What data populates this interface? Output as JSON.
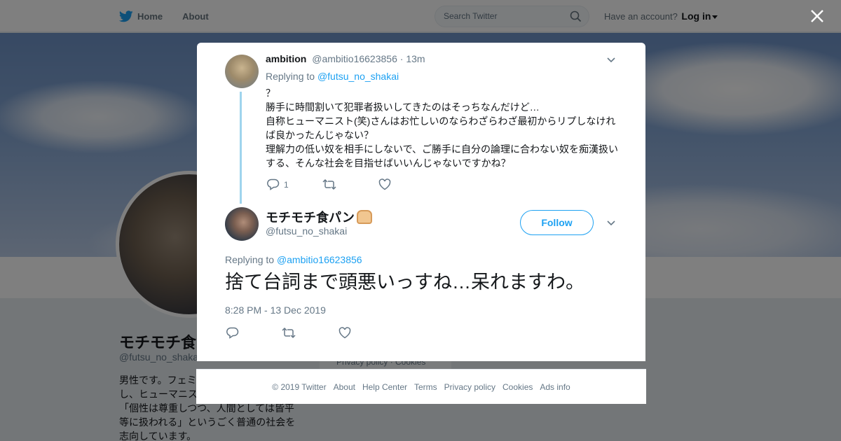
{
  "nav": {
    "home_label": "Home",
    "about_label": "About",
    "search_placeholder": "Search Twitter",
    "have_account": "Have an account?",
    "login_label": "Log in"
  },
  "profile": {
    "name": "モチモチ食パン",
    "handle": "@futsu_no_shakai",
    "bio": "男性です。フェミニストではありませんし、ヒューマニストも名乗りません。「個性は尊重しつつ、人間としては皆平等に扱われる」というごく普通の社会を志向しています。",
    "side_footer": "Privacy policy · Cookies"
  },
  "reply_tweet": {
    "author_name": "ambition",
    "author_handle": "@ambitio16623856",
    "separator": "·",
    "time_ago": "13m",
    "replying_prefix": "Replying to",
    "replying_to": "@futsu_no_shakai",
    "line1": "？",
    "line2": "勝手に時間割いて犯罪者扱いしてきたのはそっちなんだけど…",
    "line3": "自称ヒューマニスト(笑)さんはお忙しいのならわざらわざ最初からリプしなければ良かったんじゃない？",
    "line4": "理解力の低い奴を相手にしないで、ご勝手に自分の論理に合わない奴を痴漢扱いする、そんな社会を目指せばいいんじゃないですかね？",
    "reply_count": "1"
  },
  "main_tweet": {
    "author_name": "モチモチ食パン",
    "author_handle": "@futsu_no_shakai",
    "follow_label": "Follow",
    "replying_prefix": "Replying to",
    "replying_to": "@ambitio16623856",
    "text": "捨て台詞まで頭悪いっすね…呆れますわ。",
    "timestamp": "8:28 PM - 13 Dec 2019"
  },
  "footer": {
    "copyright": "© 2019 Twitter",
    "about": "About",
    "help": "Help Center",
    "terms": "Terms",
    "privacy": "Privacy policy",
    "cookies": "Cookies",
    "ads": "Ads info"
  },
  "colors": {
    "accent": "#1da1f2",
    "thread_line": "#9fd4ed",
    "muted_text": "#657786"
  },
  "icons": [
    "twitter-bird-icon",
    "home-icon",
    "search-icon",
    "close-icon",
    "chevron-down-icon",
    "reply-icon",
    "retweet-icon",
    "like-icon"
  ]
}
